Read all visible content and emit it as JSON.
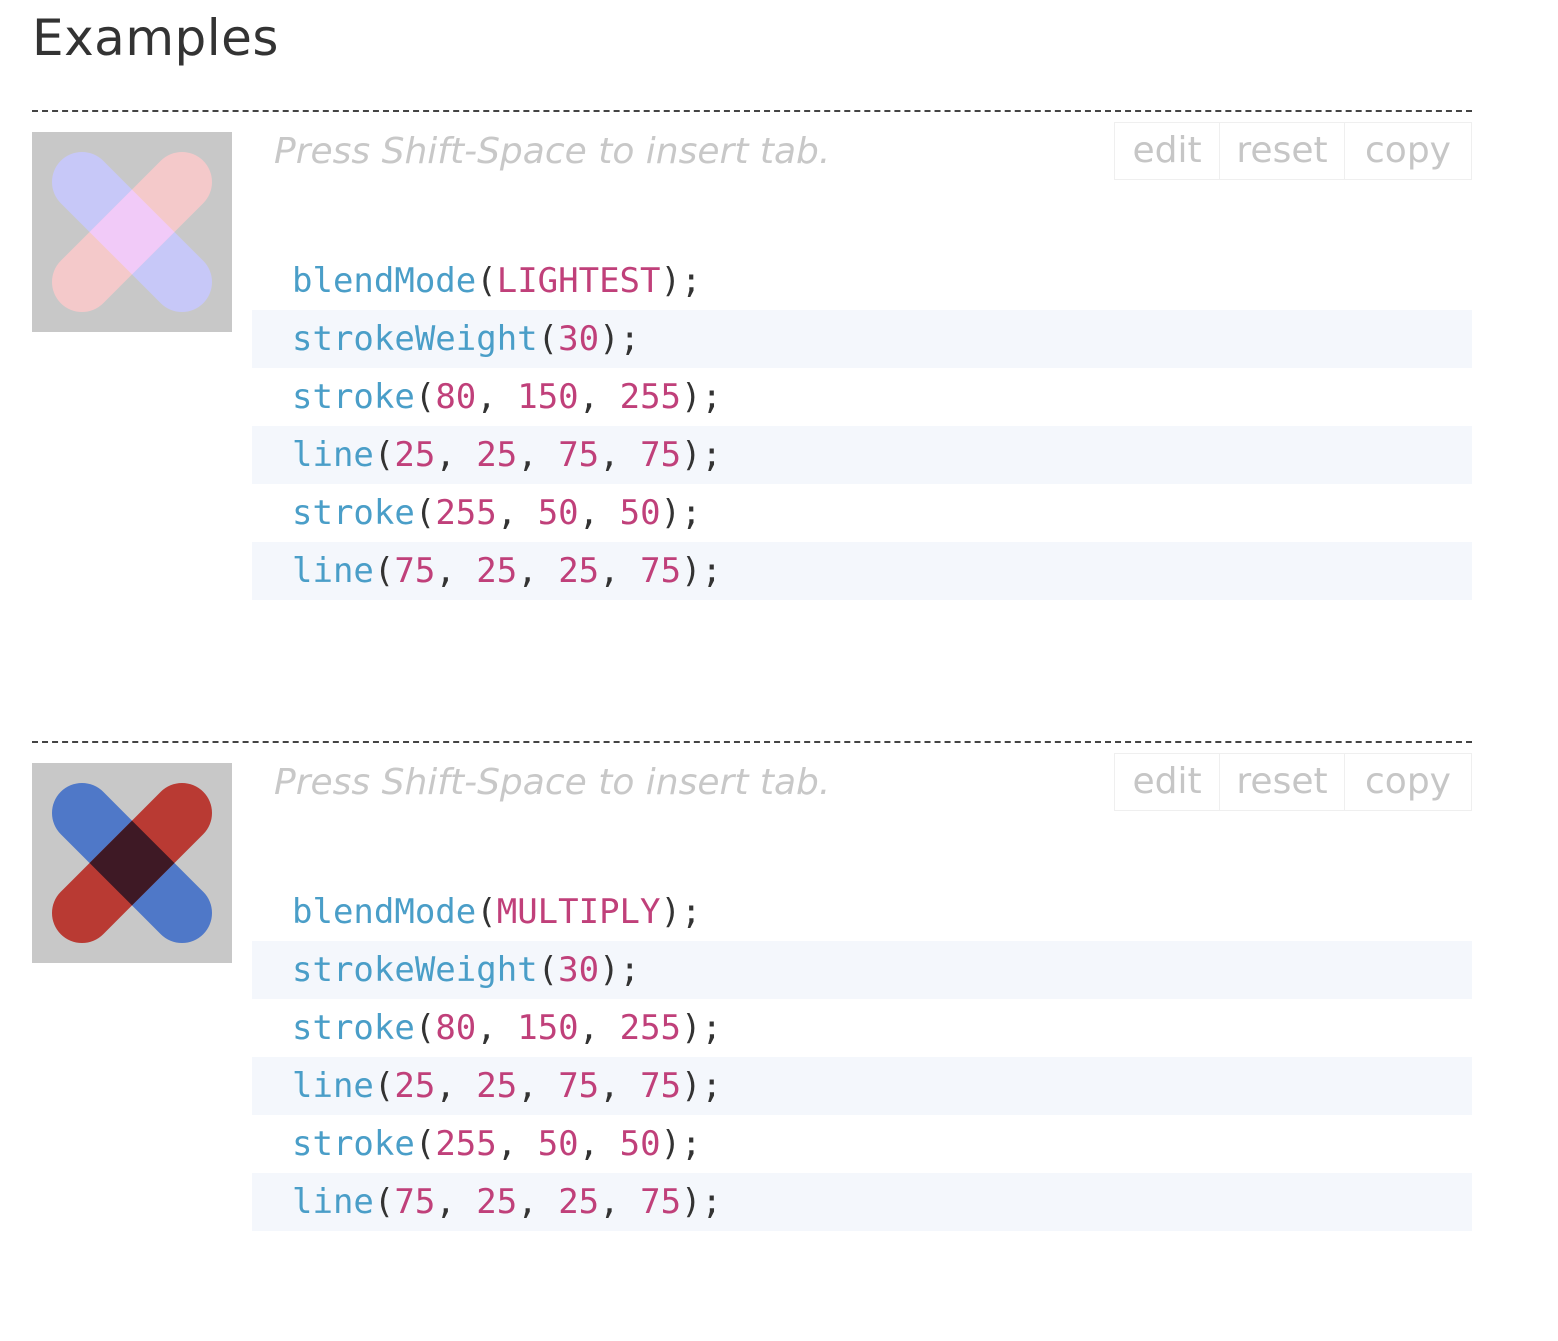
{
  "page": {
    "heading": "Examples"
  },
  "colors": {
    "function": "#4a9ec8",
    "literal": "#c0407a",
    "punctuation": "#333333",
    "alt_row_background": "#f4f7fc",
    "canvas_background": "#c8c8c8"
  },
  "examples": [
    {
      "preview_icon": "blend-mode-lightest-icon",
      "preview_colors": {
        "background": "#c8c8c8",
        "stroke_a": "#c7c8f8",
        "stroke_b": "#f4c9ca",
        "overlap": "#f1caf8"
      },
      "hint": "Press Shift-Space to insert tab.",
      "buttons": {
        "edit": "edit",
        "reset": "reset",
        "copy": "copy"
      },
      "code": [
        [
          {
            "t": "fn",
            "v": "blendMode"
          },
          {
            "t": "punc",
            "v": "("
          },
          {
            "t": "kw",
            "v": "LIGHTEST"
          },
          {
            "t": "punc",
            "v": ");"
          }
        ],
        [
          {
            "t": "fn",
            "v": "strokeWeight"
          },
          {
            "t": "punc",
            "v": "("
          },
          {
            "t": "num",
            "v": "30"
          },
          {
            "t": "punc",
            "v": ");"
          }
        ],
        [
          {
            "t": "fn",
            "v": "stroke"
          },
          {
            "t": "punc",
            "v": "("
          },
          {
            "t": "num",
            "v": "80"
          },
          {
            "t": "punc",
            "v": ", "
          },
          {
            "t": "num",
            "v": "150"
          },
          {
            "t": "punc",
            "v": ", "
          },
          {
            "t": "num",
            "v": "255"
          },
          {
            "t": "punc",
            "v": ");"
          }
        ],
        [
          {
            "t": "fn",
            "v": "line"
          },
          {
            "t": "punc",
            "v": "("
          },
          {
            "t": "num",
            "v": "25"
          },
          {
            "t": "punc",
            "v": ", "
          },
          {
            "t": "num",
            "v": "25"
          },
          {
            "t": "punc",
            "v": ", "
          },
          {
            "t": "num",
            "v": "75"
          },
          {
            "t": "punc",
            "v": ", "
          },
          {
            "t": "num",
            "v": "75"
          },
          {
            "t": "punc",
            "v": ");"
          }
        ],
        [
          {
            "t": "fn",
            "v": "stroke"
          },
          {
            "t": "punc",
            "v": "("
          },
          {
            "t": "num",
            "v": "255"
          },
          {
            "t": "punc",
            "v": ", "
          },
          {
            "t": "num",
            "v": "50"
          },
          {
            "t": "punc",
            "v": ", "
          },
          {
            "t": "num",
            "v": "50"
          },
          {
            "t": "punc",
            "v": ");"
          }
        ],
        [
          {
            "t": "fn",
            "v": "line"
          },
          {
            "t": "punc",
            "v": "("
          },
          {
            "t": "num",
            "v": "75"
          },
          {
            "t": "punc",
            "v": ", "
          },
          {
            "t": "num",
            "v": "25"
          },
          {
            "t": "punc",
            "v": ", "
          },
          {
            "t": "num",
            "v": "25"
          },
          {
            "t": "punc",
            "v": ", "
          },
          {
            "t": "num",
            "v": "75"
          },
          {
            "t": "punc",
            "v": ");"
          }
        ]
      ]
    },
    {
      "preview_icon": "blend-mode-multiply-icon",
      "preview_colors": {
        "background": "#c8c8c8",
        "stroke_a": "#4f78c8",
        "stroke_b": "#b93a33",
        "overlap": "#3e1925"
      },
      "hint": "Press Shift-Space to insert tab.",
      "buttons": {
        "edit": "edit",
        "reset": "reset",
        "copy": "copy"
      },
      "code": [
        [
          {
            "t": "fn",
            "v": "blendMode"
          },
          {
            "t": "punc",
            "v": "("
          },
          {
            "t": "kw",
            "v": "MULTIPLY"
          },
          {
            "t": "punc",
            "v": ");"
          }
        ],
        [
          {
            "t": "fn",
            "v": "strokeWeight"
          },
          {
            "t": "punc",
            "v": "("
          },
          {
            "t": "num",
            "v": "30"
          },
          {
            "t": "punc",
            "v": ");"
          }
        ],
        [
          {
            "t": "fn",
            "v": "stroke"
          },
          {
            "t": "punc",
            "v": "("
          },
          {
            "t": "num",
            "v": "80"
          },
          {
            "t": "punc",
            "v": ", "
          },
          {
            "t": "num",
            "v": "150"
          },
          {
            "t": "punc",
            "v": ", "
          },
          {
            "t": "num",
            "v": "255"
          },
          {
            "t": "punc",
            "v": ");"
          }
        ],
        [
          {
            "t": "fn",
            "v": "line"
          },
          {
            "t": "punc",
            "v": "("
          },
          {
            "t": "num",
            "v": "25"
          },
          {
            "t": "punc",
            "v": ", "
          },
          {
            "t": "num",
            "v": "25"
          },
          {
            "t": "punc",
            "v": ", "
          },
          {
            "t": "num",
            "v": "75"
          },
          {
            "t": "punc",
            "v": ", "
          },
          {
            "t": "num",
            "v": "75"
          },
          {
            "t": "punc",
            "v": ");"
          }
        ],
        [
          {
            "t": "fn",
            "v": "stroke"
          },
          {
            "t": "punc",
            "v": "("
          },
          {
            "t": "num",
            "v": "255"
          },
          {
            "t": "punc",
            "v": ", "
          },
          {
            "t": "num",
            "v": "50"
          },
          {
            "t": "punc",
            "v": ", "
          },
          {
            "t": "num",
            "v": "50"
          },
          {
            "t": "punc",
            "v": ");"
          }
        ],
        [
          {
            "t": "fn",
            "v": "line"
          },
          {
            "t": "punc",
            "v": "("
          },
          {
            "t": "num",
            "v": "75"
          },
          {
            "t": "punc",
            "v": ", "
          },
          {
            "t": "num",
            "v": "25"
          },
          {
            "t": "punc",
            "v": ", "
          },
          {
            "t": "num",
            "v": "25"
          },
          {
            "t": "punc",
            "v": ", "
          },
          {
            "t": "num",
            "v": "75"
          },
          {
            "t": "punc",
            "v": ");"
          }
        ]
      ]
    }
  ]
}
